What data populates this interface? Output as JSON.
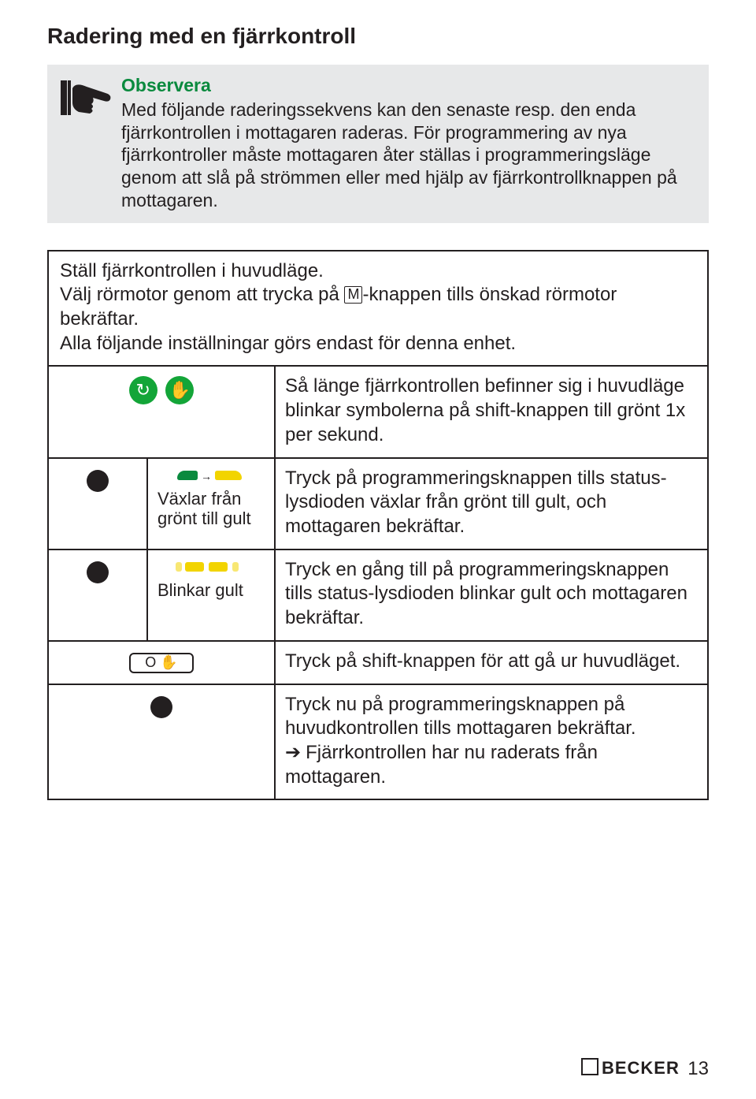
{
  "title": "Radering med en fjärrkontroll",
  "notice": {
    "heading": "Observera",
    "body": "Med följande raderingssekvens kan den senaste resp. den enda fjärrkontrollen i mottagaren raderas. För programmering av nya fjärrkontroller måste mottagaren åter ställas i programmeringsläge genom att slå på strömmen eller med hjälp av fjärrkontrollknappen på mottagaren."
  },
  "intro": {
    "l1": "Ställ fjärrkontrollen i huvudläge.",
    "l2a": "Välj rörmotor genom att trycka på ",
    "l2b": "-knappen tills önskad rörmotor bekräftar.",
    "l3": "Alla följande inställningar görs endast för denna enhet."
  },
  "rows": {
    "r1": {
      "text": "Så länge fjärrkontrollen befinner sig i huvudläge blinkar symbolerna på shift-knappen till grönt 1x per sekund."
    },
    "r2": {
      "led": "Växlar från grönt till gult",
      "text": "Tryck på programmeringsknappen tills status-lysdioden växlar från grönt till gult, och mottagaren bekräftar."
    },
    "r3": {
      "led": "Blinkar gult",
      "text": "Tryck en gång till på programmeringsknappen tills status-lysdioden blinkar gult och mottagaren bekräftar."
    },
    "r4": {
      "text": "Tryck på shift-knappen för att gå ur huvudläget."
    },
    "r5": {
      "text": "Tryck nu på programmeringsknappen på huvudkontrollen tills mottagaren bekräftar.",
      "result": "Fjärrkontrollen har nu raderats från mottagaren."
    }
  },
  "shift_label": "O ✋",
  "m_key": "M",
  "icons": {
    "refresh": "↻",
    "hand": "✋"
  },
  "brand": "BECKER",
  "page_number": "13"
}
